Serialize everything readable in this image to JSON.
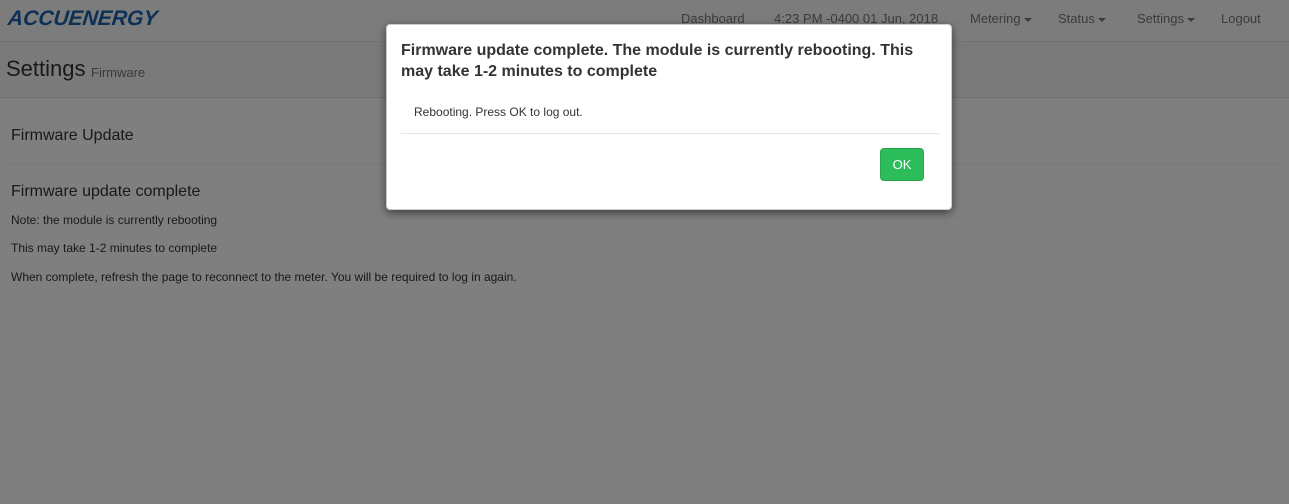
{
  "brand": {
    "logo_text": "ACCUENERGY"
  },
  "navbar": {
    "dashboard": "Dashboard",
    "datetime": "4:23 PM -0400 01 Jun, 2018",
    "metering": "Metering",
    "status": "Status",
    "settings": "Settings",
    "logout": "Logout"
  },
  "header": {
    "title": "Settings",
    "subtitle": "Firmware"
  },
  "content": {
    "section_title": "Firmware Update",
    "subheading": "Firmware update complete",
    "lines": [
      "Note: the module is currently rebooting",
      "This may take 1-2 minutes to complete",
      "When complete, refresh the page to reconnect to the meter. You will be required to log in again."
    ]
  },
  "modal": {
    "title": "Firmware update complete. The module is currently rebooting. This may take 1-2 minutes to complete",
    "body": "Rebooting. Press OK to log out.",
    "ok_label": "OK"
  },
  "colors": {
    "brand_blue": "#1a63a8",
    "brand_green": "#2ea84a",
    "ok_green": "#2dbc5a"
  }
}
